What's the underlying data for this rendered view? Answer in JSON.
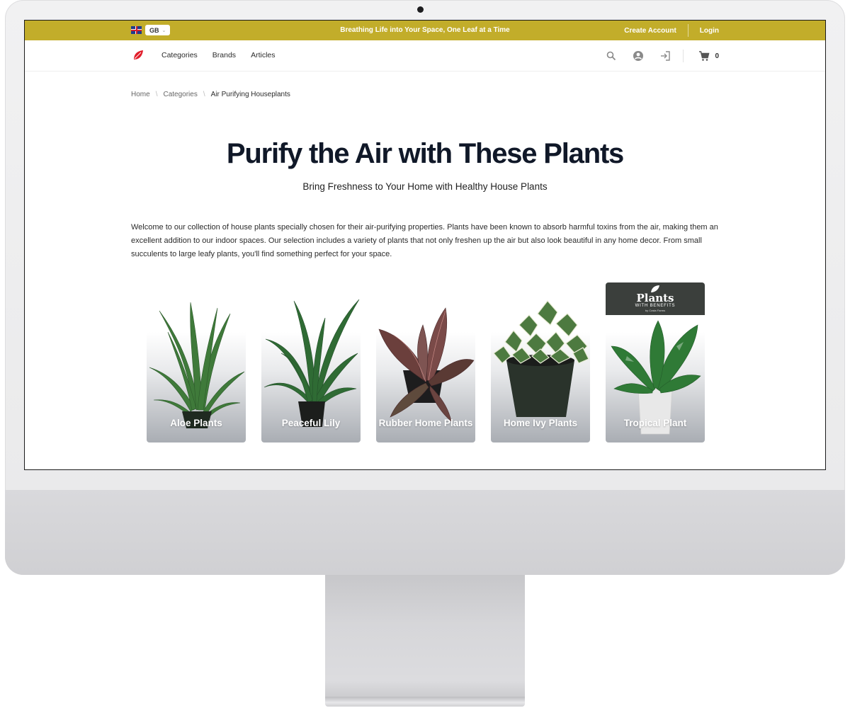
{
  "topbar": {
    "lang_code": "GB",
    "slogan": "Breathing Life into Your Space, One Leaf at a Time",
    "create_account": "Create Account",
    "login": "Login"
  },
  "nav": {
    "links": [
      "Categories",
      "Brands",
      "Articles"
    ],
    "cart_count": "0"
  },
  "breadcrumb": {
    "home": "Home",
    "categories": "Categories",
    "current": "Air Purifying Houseplants"
  },
  "hero": {
    "title": "Purify the Air with These Plants",
    "subtitle": "Bring Freshness to Your Home with Healthy House Plants"
  },
  "intro": "Welcome to our collection of house plants specially chosen for their air-purifying properties. Plants have been known to absorb harmful toxins from the air, making them an excellent addition to our indoor spaces. Our selection includes a variety of plants that not only freshen up the air but also look beautiful in any home decor. From small succulents to large leafy plants, you'll find something perfect for your space.",
  "cards": [
    {
      "label": "Aloe Plants"
    },
    {
      "label": "Peaceful Lily"
    },
    {
      "label": "Rubber Home Plants"
    },
    {
      "label": "Home Ivy Plants"
    },
    {
      "label": "Tropical Plant"
    }
  ],
  "brand_banner": {
    "name": "Plants",
    "tagline": "WITH BENEFITS",
    "byline": "by Costa Farms"
  },
  "colors": {
    "topbar": "#c2ad2a",
    "logo": "#e11d2a",
    "title": "#101828"
  }
}
